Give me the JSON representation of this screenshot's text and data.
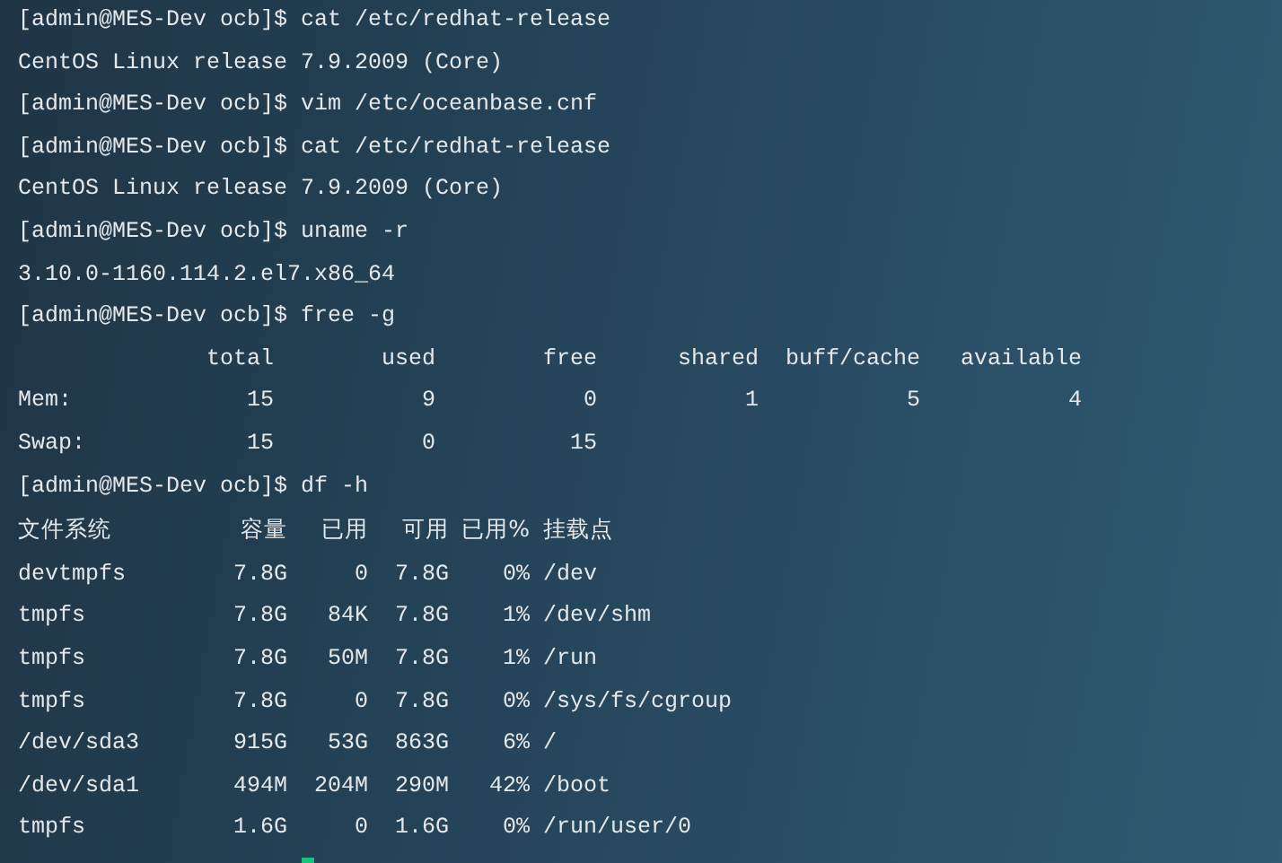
{
  "terminal": {
    "lines": [
      {
        "kind": "prompt",
        "prompt": "[admin@MES-Dev ocb]$",
        "command": "cat /etc/redhat-release"
      },
      {
        "kind": "output",
        "text": "CentOS Linux release 7.9.2009 (Core)"
      },
      {
        "kind": "prompt",
        "prompt": "[admin@MES-Dev ocb]$",
        "command": "vim /etc/oceanbase.cnf"
      },
      {
        "kind": "prompt",
        "prompt": "[admin@MES-Dev ocb]$",
        "command": "cat /etc/redhat-release"
      },
      {
        "kind": "output",
        "text": "CentOS Linux release 7.9.2009 (Core)"
      },
      {
        "kind": "prompt",
        "prompt": "[admin@MES-Dev ocb]$",
        "command": "uname -r"
      },
      {
        "kind": "output",
        "text": "3.10.0-1160.114.2.el7.x86_64"
      },
      {
        "kind": "prompt",
        "prompt": "[admin@MES-Dev ocb]$",
        "command": "free -g"
      },
      {
        "kind": "free_table",
        "columns": [
          "total",
          "used",
          "free",
          "shared",
          "buff/cache",
          "available"
        ],
        "rows": [
          {
            "label": "Mem:",
            "cells": [
              "15",
              "9",
              "0",
              "1",
              "5",
              "4"
            ]
          },
          {
            "label": "Swap:",
            "cells": [
              "15",
              "0",
              "15"
            ]
          }
        ]
      },
      {
        "kind": "prompt",
        "prompt": "[admin@MES-Dev ocb]$",
        "command": "df -h"
      },
      {
        "kind": "df_table",
        "columns": [
          "文件系统",
          "容量",
          "已用",
          "可用",
          "已用%",
          "挂载点"
        ],
        "rows": [
          [
            "devtmpfs",
            "7.8G",
            "0",
            "7.8G",
            "0%",
            "/dev"
          ],
          [
            "tmpfs",
            "7.8G",
            "84K",
            "7.8G",
            "1%",
            "/dev/shm"
          ],
          [
            "tmpfs",
            "7.8G",
            "50M",
            "7.8G",
            "1%",
            "/run"
          ],
          [
            "tmpfs",
            "7.8G",
            "0",
            "7.8G",
            "0%",
            "/sys/fs/cgroup"
          ],
          [
            "/dev/sda3",
            "915G",
            "53G",
            "863G",
            "6%",
            "/"
          ],
          [
            "/dev/sda1",
            "494M",
            "204M",
            "290M",
            "42%",
            "/boot"
          ],
          [
            "tmpfs",
            "1.6G",
            "0",
            "1.6G",
            "0%",
            "/run/user/0"
          ]
        ]
      },
      {
        "kind": "cursor"
      }
    ]
  }
}
